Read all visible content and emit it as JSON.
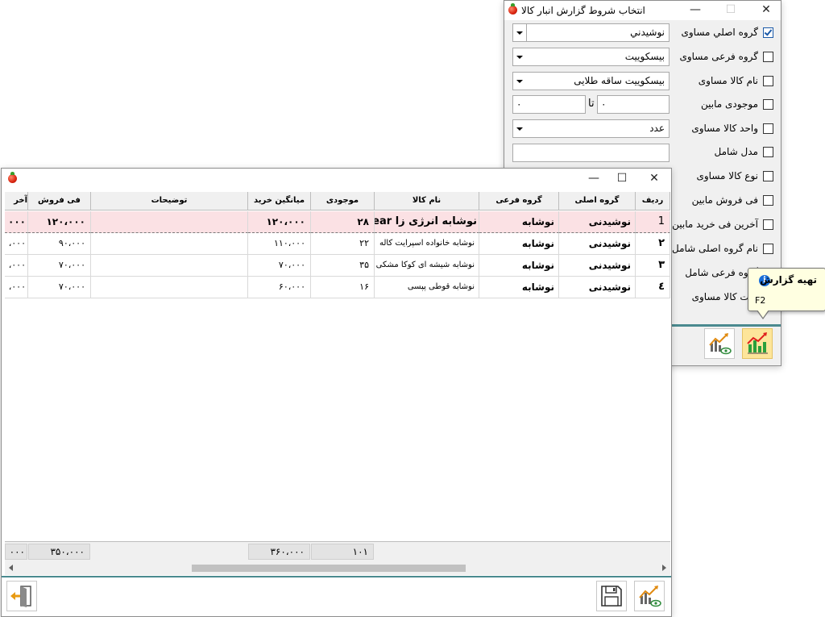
{
  "filter_window": {
    "title": "انتخاب شروط گزارش انبار کالا",
    "conditions": [
      {
        "label": "گروه اصلي مساوی",
        "checked": true
      },
      {
        "label": "گروه فرعی مساوی",
        "checked": false
      },
      {
        "label": "نام کالا مساوی",
        "checked": false
      },
      {
        "label": "موجودی مابین",
        "checked": false
      },
      {
        "label": "واحد کالا مساوی",
        "checked": false
      },
      {
        "label": "مدل شامل",
        "checked": false
      },
      {
        "label": "نوع کالا مساوی",
        "checked": false
      },
      {
        "label": "فی فروش مابین",
        "checked": false
      },
      {
        "label": "آخرین فی خرید مابین",
        "checked": false
      },
      {
        "label": "نام گروه اصلی شامل",
        "checked": false
      },
      {
        "label": "گروه فرعی شامل",
        "checked": false
      },
      {
        "label": "عیت کالا مساوی",
        "checked": false
      }
    ],
    "main_group_value": "نوشيدني",
    "sub_group_value": "بیسکوییت",
    "product_name_value": "بیسکوییت ساقه طلایی",
    "stock_from": "۰",
    "stock_to_label": "تا",
    "stock_to": "۰",
    "unit_value": "عدد",
    "model_value": ""
  },
  "tooltip": {
    "title": "تهیه گزارش",
    "shortcut": "F2"
  },
  "report_window": {
    "columns": [
      "ردیف",
      "گروه اصلی",
      "گروه فرعی",
      "نام کالا",
      "موجودی",
      "میانگین خرید",
      "توضیحات",
      "فی فروش",
      "آخر"
    ],
    "rows": [
      {
        "idx": "1",
        "main_group": "نوشیدنی",
        "sub_group": "نوشابه",
        "name": "نوشابه انرژی زا big bear",
        "stock": "۲۸",
        "avg_buy": "۱۲۰،۰۰۰",
        "desc": "",
        "sell": "۱۲۰،۰۰۰",
        "last": "۰۰۰"
      },
      {
        "idx": "۲",
        "main_group": "نوشیدنی",
        "sub_group": "نوشابه",
        "name": "نوشابه خانواده اسپرایت کاله",
        "stock": "۲۲",
        "avg_buy": "۱۱۰،۰۰۰",
        "desc": "",
        "sell": "۹۰،۰۰۰",
        "last": "۰۰۰،"
      },
      {
        "idx": "۳",
        "main_group": "نوشیدنی",
        "sub_group": "نوشابه",
        "name": "نوشابه شیشه ای کوکا مشکی",
        "stock": "۳۵",
        "avg_buy": "۷۰،۰۰۰",
        "desc": "",
        "sell": "۷۰،۰۰۰",
        "last": "۰۰۰،"
      },
      {
        "idx": "٤",
        "main_group": "نوشیدنی",
        "sub_group": "نوشابه",
        "name": "نوشابه قوطی پپسی",
        "stock": "۱۶",
        "avg_buy": "۶۰،۰۰۰",
        "desc": "",
        "sell": "۷۰،۰۰۰",
        "last": "۰۰۰،"
      }
    ],
    "totals": {
      "stock": "۱۰۱",
      "avg_buy": "۳۶۰،۰۰۰",
      "sell": "۳۵۰،۰۰۰",
      "last": "۰۰۰"
    }
  },
  "colors": {
    "selected_row": "#fbe1e4",
    "separator": "#4a8a8f",
    "highlight_button": "#fde59a",
    "tooltip_bg": "#ffffe1"
  }
}
